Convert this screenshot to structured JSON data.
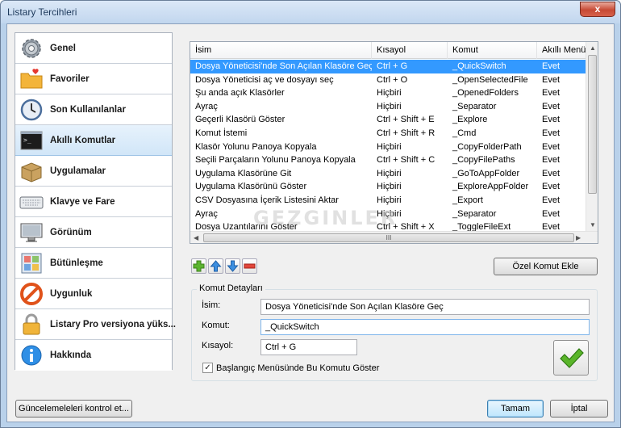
{
  "window": {
    "title": "Listary Tercihleri",
    "close_label": "x"
  },
  "sidebar": {
    "items": [
      {
        "label": "Genel",
        "icon": "gear-icon"
      },
      {
        "label": "Favoriler",
        "icon": "folder-heart-icon"
      },
      {
        "label": "Son Kullanılanlar",
        "icon": "clock-icon"
      },
      {
        "label": "Akıllı Komutlar",
        "icon": "terminal-icon"
      },
      {
        "label": "Uygulamalar",
        "icon": "box-icon"
      },
      {
        "label": "Klavye ve Fare",
        "icon": "keyboard-icon"
      },
      {
        "label": "Görünüm",
        "icon": "monitor-icon"
      },
      {
        "label": "Bütünleşme",
        "icon": "puzzle-icon"
      },
      {
        "label": "Uygunluk",
        "icon": "no-entry-icon"
      },
      {
        "label": "Listary Pro versiyona yüks...",
        "icon": "lock-icon"
      },
      {
        "label": "Hakkında",
        "icon": "info-icon"
      }
    ],
    "selected_index": 3
  },
  "list": {
    "columns": [
      "İsim",
      "Kısayol",
      "Komut",
      "Akıllı Menü'd"
    ],
    "selected_index": 0,
    "rows": [
      [
        "Dosya Yöneticisi'nde Son Açılan Klasöre Geç",
        "Ctrl + G",
        "_QuickSwitch",
        "Evet"
      ],
      [
        "Dosya Yöneticisi aç ve dosyayı seç",
        "Ctrl + O",
        "_OpenSelectedFile",
        "Evet"
      ],
      [
        "Şu anda açık Klasörler",
        "Hiçbiri",
        "_OpenedFolders",
        "Evet"
      ],
      [
        "Ayraç",
        "Hiçbiri",
        "_Separator",
        "Evet"
      ],
      [
        "Geçerli Klasörü Göster",
        "Ctrl + Shift + E",
        "_Explore",
        "Evet"
      ],
      [
        "Komut İstemi",
        "Ctrl + Shift + R",
        "_Cmd",
        "Evet"
      ],
      [
        "Klasör Yolunu Panoya Kopyala",
        "Hiçbiri",
        "_CopyFolderPath",
        "Evet"
      ],
      [
        "Seçili Parçaların Yolunu Panoya Kopyala",
        "Ctrl + Shift + C",
        "_CopyFilePaths",
        "Evet"
      ],
      [
        "Uygulama Klasörüne Git",
        "Hiçbiri",
        "_GoToAppFolder",
        "Evet"
      ],
      [
        "Uygulama Klasörünü Göster",
        "Hiçbiri",
        "_ExploreAppFolder",
        "Evet"
      ],
      [
        "CSV Dosyasına İçerik Listesini Aktar",
        "Hiçbiri",
        "_Export",
        "Evet"
      ],
      [
        "Ayraç",
        "Hiçbiri",
        "_Separator",
        "Evet"
      ],
      [
        "Dosya Uzantılarını Göster",
        "Ctrl + Shift + X",
        "_ToggleFileExt",
        "Evet"
      ]
    ],
    "hscroll_grip": "III"
  },
  "watermark": "GEZGINLER",
  "toolbar": {
    "add_icon": "plus-icon",
    "up_icon": "arrow-up-icon",
    "down_icon": "arrow-down-icon",
    "remove_icon": "minus-icon"
  },
  "custom_button": "Özel Komut Ekle",
  "details": {
    "group_title": "Komut Detayları",
    "name_label": "İsim:",
    "name_value": "Dosya Yöneticisi'nde Son Açılan Klasöre Geç",
    "command_label": "Komut:",
    "command_value": "_QuickSwitch",
    "shortcut_label": "Kısayol:",
    "shortcut_value": "Ctrl + G",
    "checkbox_label": "Başlangıç Menüsünde Bu Komutu Göster",
    "checkbox_checked": true
  },
  "footer": {
    "update_button": "Güncelemeleleri kontrol et...",
    "ok_button": "Tamam",
    "cancel_button": "İptal"
  },
  "colors": {
    "selection": "#3399ff",
    "check": "#5ab52a"
  }
}
